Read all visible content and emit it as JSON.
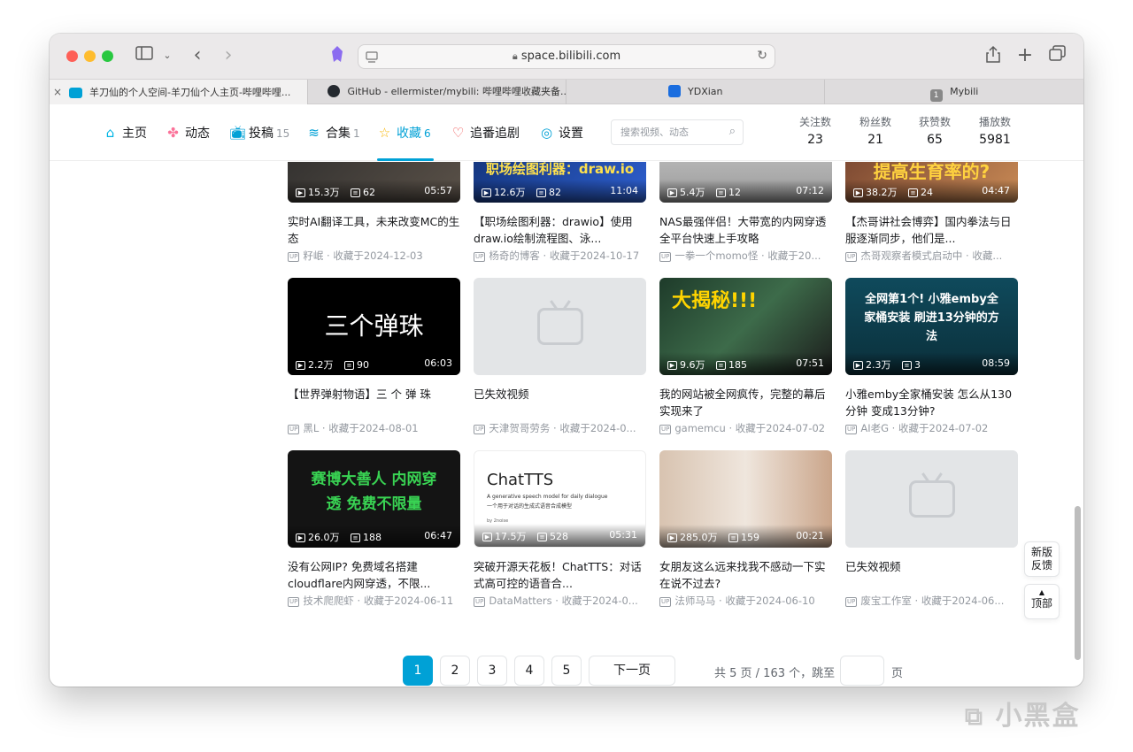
{
  "browser": {
    "url": "space.bilibili.com",
    "tabs": [
      {
        "label": "羊刀仙的个人空间-羊刀仙个人主页-哔哩哔哩...",
        "active": true
      },
      {
        "label": "GitHub - ellermister/mybili: 哔哩哔哩收藏夹备...",
        "active": false
      },
      {
        "label": "YDXian",
        "active": false
      },
      {
        "label": "Mybili",
        "active": false
      }
    ],
    "tab4_badge": "1"
  },
  "nav": {
    "items": [
      {
        "label": "主页",
        "count": ""
      },
      {
        "label": "动态",
        "count": ""
      },
      {
        "label": "投稿",
        "count": "15"
      },
      {
        "label": "合集",
        "count": "1"
      },
      {
        "label": "收藏",
        "count": "6"
      },
      {
        "label": "追番追剧",
        "count": ""
      },
      {
        "label": "设置",
        "count": ""
      }
    ],
    "search_placeholder": "搜索视频、动态",
    "stats": [
      {
        "label": "关注数",
        "value": "23"
      },
      {
        "label": "粉丝数",
        "value": "21"
      },
      {
        "label": "获赞数",
        "value": "65"
      },
      {
        "label": "播放数",
        "value": "5981"
      }
    ]
  },
  "videos": [
    {
      "views": "15.3万",
      "danmaku": "62",
      "duration": "05:57",
      "title": "实时AI翻译工具，未来改变MC的生态",
      "up": "籽岷",
      "fav": "收藏于2024-12-03",
      "thumb_text": ""
    },
    {
      "views": "12.6万",
      "danmaku": "82",
      "duration": "11:04",
      "title": "【职场绘图利器：drawio】使用draw.io绘制流程图、泳...",
      "up": "杨奇的博客",
      "fav": "收藏于2024-10-17",
      "thumb_text": "职场绘图利器：draw.io"
    },
    {
      "views": "5.4万",
      "danmaku": "12",
      "duration": "07:12",
      "title": "NAS最强伴侣！大带宽的内网穿透全平台快速上手攻略",
      "up": "一拳一个momo怪",
      "fav": "收藏于20...",
      "thumb_text": ""
    },
    {
      "views": "38.2万",
      "danmaku": "24",
      "duration": "04:47",
      "title": "【杰哥讲社会博弈】国内拳法与日服逐渐同步，他们是...",
      "up": "杰哥观察者模式启动中",
      "fav": "收藏...",
      "thumb_text": "提高生育率的?"
    },
    {
      "views": "2.2万",
      "danmaku": "90",
      "duration": "06:03",
      "title": "【世界弹射物语】三 个 弹 珠",
      "up": "黑L",
      "fav": "收藏于2024-08-01",
      "thumb_text": "三个弹珠"
    },
    {
      "views": "",
      "danmaku": "",
      "duration": "",
      "title": "已失效视频",
      "up": "天津贺哥劳务",
      "fav": "收藏于2024-0...",
      "thumb_text": ""
    },
    {
      "views": "9.6万",
      "danmaku": "185",
      "duration": "07:51",
      "title": "我的网站被全网疯传，完整的幕后实现来了",
      "up": "gamemcu",
      "fav": "收藏于2024-07-02",
      "thumb_text": "大揭秘!!!"
    },
    {
      "views": "2.3万",
      "danmaku": "3",
      "duration": "08:59",
      "title": "小雅emby全家桶安装 怎么从130分钟 变成13分钟?",
      "up": "AI老G",
      "fav": "收藏于2024-07-02",
      "thumb_text": "全网第1个! 小雅emby全家桶安装 刷进13分钟的方法"
    },
    {
      "views": "26.0万",
      "danmaku": "188",
      "duration": "06:47",
      "title": "没有公网IP? 免费域名搭建cloudflare内网穿透，不限...",
      "up": "技术爬爬虾",
      "fav": "收藏于2024-06-11",
      "thumb_text": "赛博大善人 内网穿透 免费不限量"
    },
    {
      "views": "17.5万",
      "danmaku": "528",
      "duration": "05:31",
      "title": "突破开源天花板！ChatTTS：对话式高可控的语音合...",
      "up": "DataMatters",
      "fav": "收藏于2024-0...",
      "thumb_text": "ChatTTS"
    },
    {
      "views": "285.0万",
      "danmaku": "159",
      "duration": "00:21",
      "title": "女朋友这么远来找我不感动一下实在说不过去?",
      "up": "法师马马",
      "fav": "收藏于2024-06-10",
      "thumb_text": ""
    },
    {
      "views": "",
      "danmaku": "",
      "duration": "",
      "title": "已失效视频",
      "up": "废宝工作室",
      "fav": "收藏于2024-06...",
      "thumb_text": ""
    }
  ],
  "chattts_sub1": "A generative speech model for daily dialogue",
  "chattts_sub2": "一个用于对话的生成式语音合成模型",
  "chattts_sub3": "by 2noise",
  "pagination": {
    "pages": [
      "1",
      "2",
      "3",
      "4",
      "5"
    ],
    "current": "1",
    "next_label": "下一页",
    "summary": "共 5 页 / 163 个，跳至",
    "suffix": "页"
  },
  "float": {
    "feedback": "新版反馈",
    "top": "顶部"
  },
  "watermark": "小黑盒",
  "colors": {
    "accent": "#00a1d6",
    "text": "#18191c",
    "muted": "#9499a0"
  }
}
